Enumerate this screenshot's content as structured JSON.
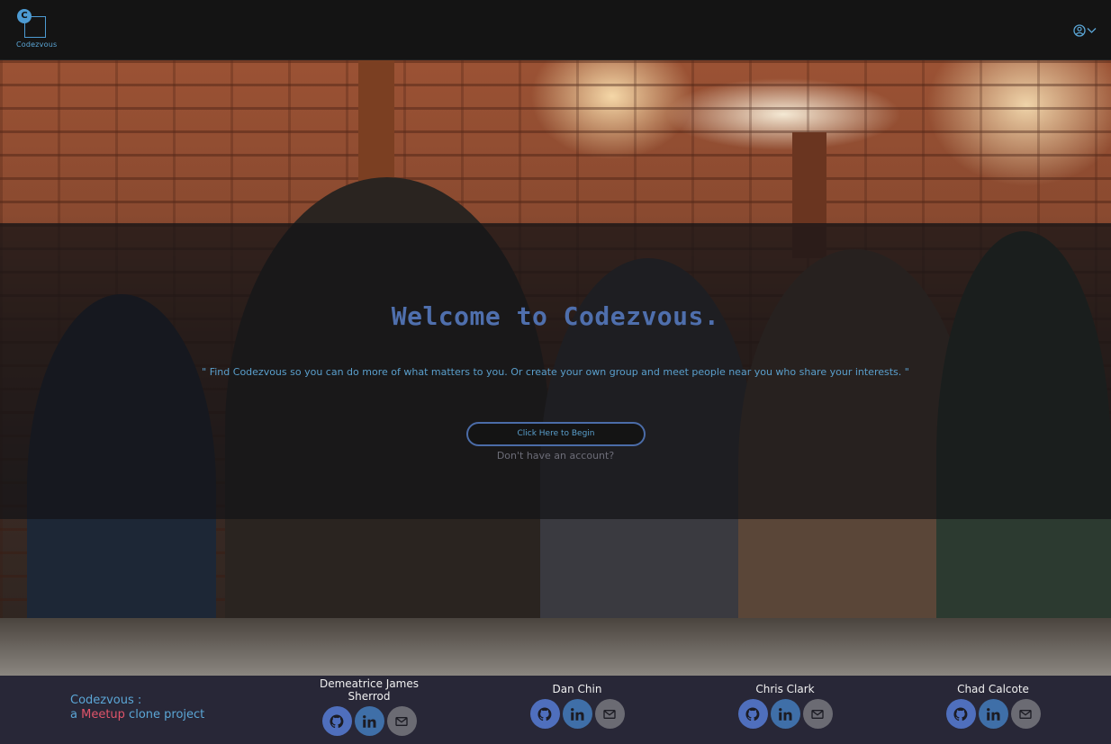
{
  "header": {
    "logo_letter": "C",
    "logo_text": "Codezvous"
  },
  "hero": {
    "title": "Welcome to Codezvous.",
    "tagline": "\" Find Codezvous so you can do more of what matters to you. Or create your own group and meet people near you who share your interests. \"",
    "begin_button": "Click Here to Begin",
    "signup_link": "Don't have an account?"
  },
  "footer": {
    "brand_line1": "Codezvous :",
    "brand_prefix": "a ",
    "brand_highlight": "Meetup",
    "brand_suffix": " clone project",
    "members": [
      {
        "name": "Demeatrice James Sherrod"
      },
      {
        "name": "Dan Chin"
      },
      {
        "name": "Chris Clark"
      },
      {
        "name": "Chad Calcote"
      }
    ]
  },
  "colors": {
    "accent_blue": "#5ba6d6",
    "title_blue": "#4f6fad",
    "meetup_red": "#e0546a",
    "footer_bg": "#282737"
  },
  "icons": [
    "user-icon",
    "chevron-down-icon",
    "github-icon",
    "linkedin-icon",
    "mail-icon"
  ]
}
